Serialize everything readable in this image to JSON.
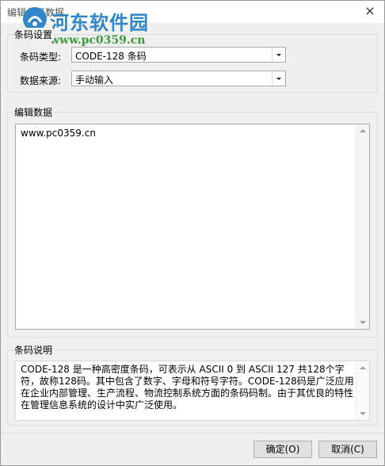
{
  "window": {
    "title": "编辑条码数据",
    "close_icon": "×"
  },
  "watermark": {
    "site_name": "河东软件园",
    "site_url": "www.pc0359.cn"
  },
  "barcode_settings": {
    "group_label": "条码设置",
    "type_label": "条码类型:",
    "type_value": "CODE-128 条码",
    "source_label": "数据来源:",
    "source_value": "手动输入"
  },
  "edit_data": {
    "group_label": "编辑数据",
    "content": "www.pc0359.cn"
  },
  "barcode_description": {
    "group_label": "条码说明",
    "content": "CODE-128 是一种高密度条码，可表示从 ASCII 0 到 ASCII 127 共128个字符，故称128码。其中包含了数字、字母和符号字符。CODE-128码是广泛应用在企业内部管理、生产流程、物流控制系统方面的条码码制。由于其优良的特性在管理信息系统的设计中实广泛使用。"
  },
  "footer": {
    "ok_label": "确定(O)",
    "cancel_label": "取消(C)"
  }
}
